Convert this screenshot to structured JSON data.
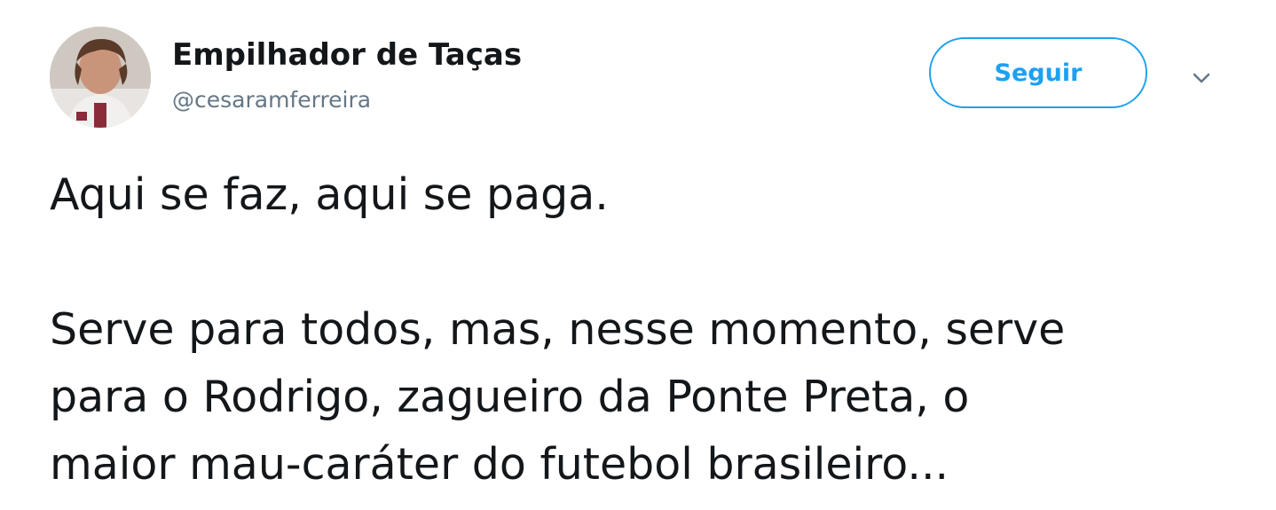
{
  "author": {
    "name": "Empilhador de Taças",
    "handle": "@cesaramferreira",
    "avatar_icon": "user-avatar-photo"
  },
  "actions": {
    "follow_label": "Seguir",
    "menu_icon": "chevron-down-icon"
  },
  "tweet": {
    "paragraph_1": "Aqui se faz, aqui se paga.",
    "paragraph_2_lines": [
      "Serve para todos, mas, nesse momento, serve",
      "para o Rodrigo, zagueiro da Ponte Preta, o",
      "maior mau-caráter do futebol brasileiro..."
    ]
  },
  "colors": {
    "accent": "#1da1f2",
    "text": "#14171a",
    "secondary_text": "#657786"
  }
}
